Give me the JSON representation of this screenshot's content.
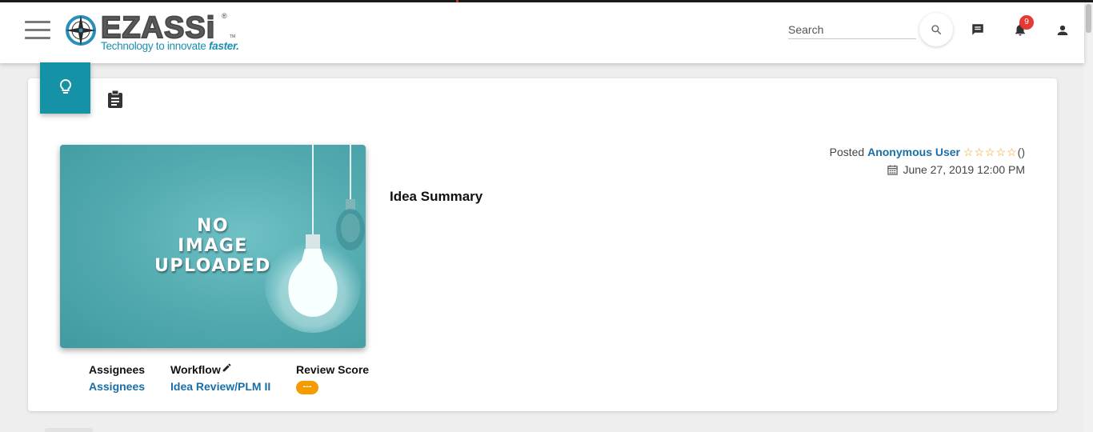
{
  "brand": {
    "name": "EZASSi",
    "registered_mark": "®",
    "tm_mark": "TM",
    "tagline_prefix": "Technology to innovate",
    "tagline_emphasis": "faster."
  },
  "header": {
    "search": {
      "placeholder": "Search",
      "value": ""
    },
    "notification_count": "9",
    "icons": [
      "menu-icon",
      "search-icon",
      "chat-icon",
      "bell-icon",
      "person-icon"
    ]
  },
  "tabs": [
    {
      "icon": "lightbulb-icon",
      "active": true
    },
    {
      "icon": "clipboard-icon",
      "active": false
    }
  ],
  "idea": {
    "image_placeholder": [
      "NO",
      "IMAGE",
      "UPLOADED"
    ],
    "posted_label": "Posted",
    "posted_by": "Anonymous User",
    "stars": "☆☆☆☆☆",
    "rating_count": "()",
    "date": "June 27, 2019 12:00 PM",
    "title": "Idea Summary"
  },
  "meta": {
    "assignees_label": "Assignees",
    "assignees_value": "Assignees",
    "workflow_label": "Workflow",
    "workflow_value": "Idea Review/PLM II",
    "review_score_label": "Review Score",
    "review_score_value": "---"
  },
  "colors": {
    "accent": "#1592a6",
    "link": "#1a6ea6",
    "star": "#f39c12",
    "badge": "#e53935",
    "score_pill": "#f59b00"
  }
}
